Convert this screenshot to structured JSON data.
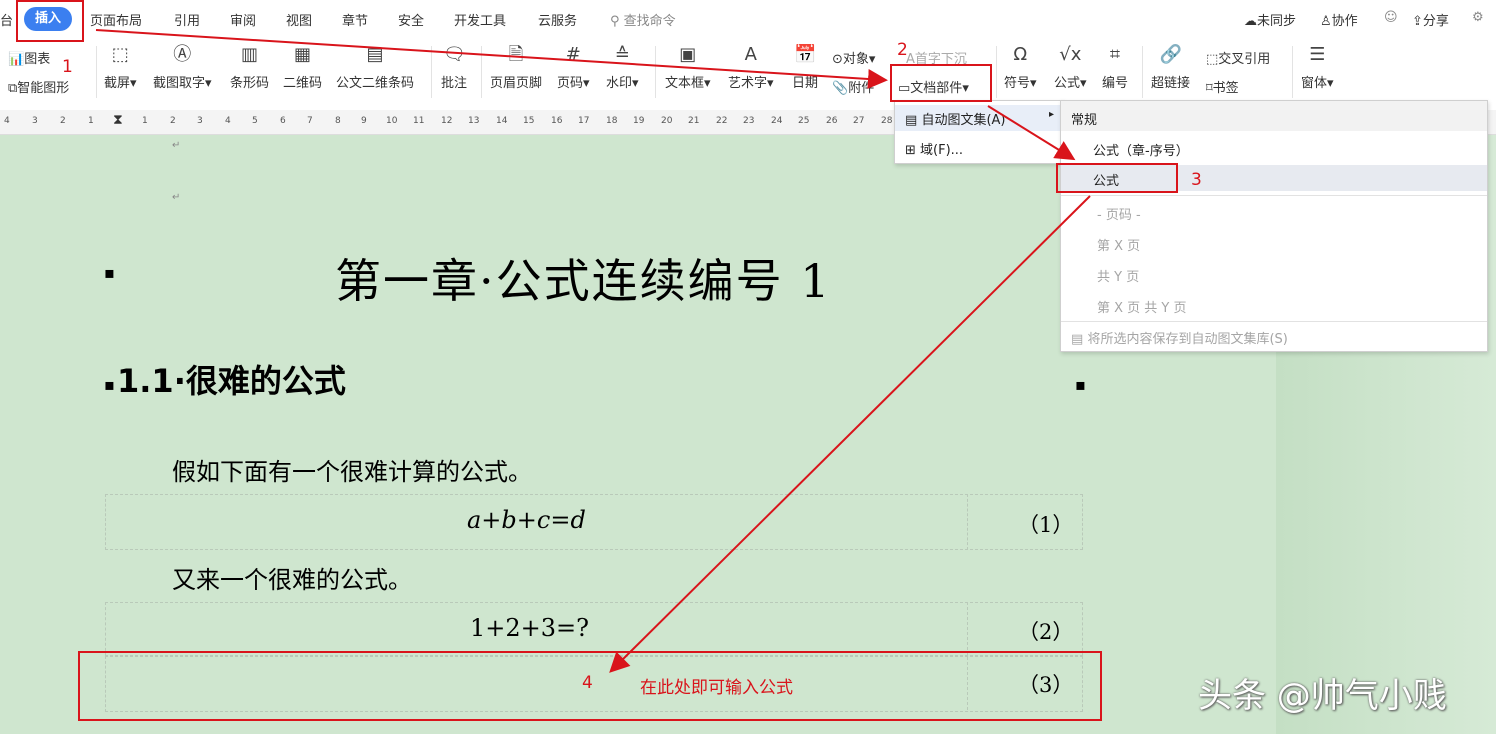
{
  "menubar": {
    "left_partial": "台",
    "active_tab": "插入",
    "tabs": [
      "页面布局",
      "引用",
      "审阅",
      "视图",
      "章节",
      "安全",
      "开发工具",
      "云服务"
    ],
    "search_placeholder": "查找命令",
    "right": {
      "sync": "未同步",
      "collab": "协作",
      "share": "分享"
    }
  },
  "ribbon": {
    "chart": "图表",
    "smart_shape": "智能图形",
    "screenshot": "截屏",
    "screenshot_text": "截图取字",
    "barcode": "条形码",
    "qrcode": "二维码",
    "doc_qrcode": "公文二维条码",
    "comment": "批注",
    "header_footer": "页眉页脚",
    "page_number": "页码",
    "watermark": "水印",
    "textbox": "文本框",
    "wordart": "艺术字",
    "date": "日期",
    "object": "对象",
    "attachment": "附件",
    "drop_cap": "首字下沉",
    "doc_parts": "文档部件",
    "symbol": "符号",
    "formula": "公式",
    "numbering": "编号",
    "hyperlink": "超链接",
    "cross_ref": "交叉引用",
    "bookmark": "书签",
    "form": "窗体"
  },
  "ruler": {
    "ticks": [
      "4",
      "3",
      "2",
      "1",
      "1",
      "2",
      "3",
      "4",
      "5",
      "6",
      "7",
      "8",
      "9",
      "10",
      "11",
      "12",
      "13",
      "14",
      "15",
      "16",
      "17",
      "18",
      "19",
      "20",
      "21",
      "22",
      "23",
      "24",
      "25",
      "26",
      "27",
      "28"
    ]
  },
  "document": {
    "heading1": "第一章·公式连续编号 1",
    "heading2": "1.1·很难的公式",
    "para1": "假如下面有一个很难计算的公式。",
    "formula1": "a+b+c=d",
    "num1": "（1）",
    "para2": "又来一个很难的公式。",
    "formula2": "1+2+3=?",
    "num2": "（2）",
    "num3": "（3）",
    "instruction": "在此处即可输入公式"
  },
  "dropdown1": {
    "autotext": "自动图文集(A)",
    "field": "域(F)..."
  },
  "dropdown2": {
    "section": "常规",
    "formula_chapter": "公式（章-序号）",
    "formula": "公式",
    "page_header": "- 页码 -",
    "page_x": "第 X 页",
    "total_y": "共 Y 页",
    "page_x_of_y": "第 X 页 共 Y 页",
    "save_to_gallery": "将所选内容保存到自动图文集库(S)"
  },
  "annotations": {
    "n1": "1",
    "n2": "2",
    "n3": "3",
    "n4": "4"
  },
  "watermark": "头条 @帅气小贱",
  "colors": {
    "accent": "#3b7ff0",
    "annotation_red": "#d9141b",
    "doc_bg": "#cfe6cf"
  }
}
